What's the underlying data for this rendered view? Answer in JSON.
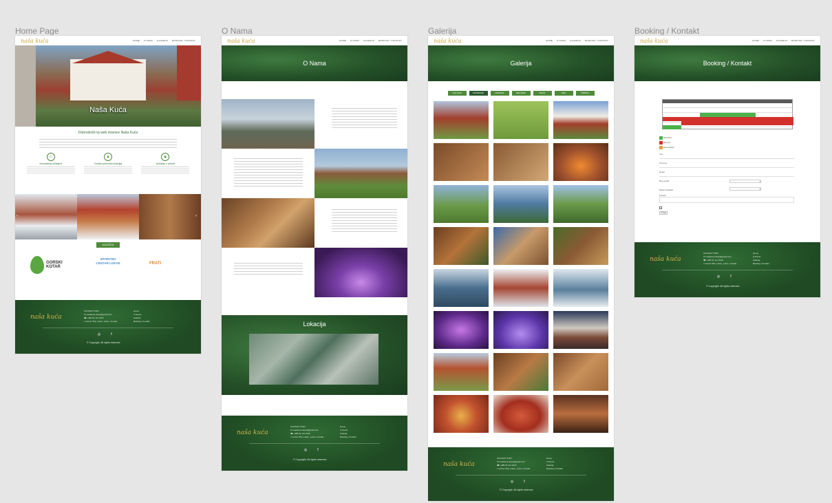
{
  "frames": [
    {
      "title": "Home Page"
    },
    {
      "title": "O Nama"
    },
    {
      "title": "Galerija"
    },
    {
      "title": "Booking / Kontakt"
    }
  ],
  "brand": {
    "logo": "naša kuća",
    "green": "#2f6b34",
    "accent": "#c8a23a",
    "button": "#4f8a3c"
  },
  "nav": {
    "items": [
      "HOME",
      "O NAMA",
      "GALERIJA",
      "BOOKING / KONTAKT"
    ]
  },
  "home": {
    "hero_title": "Naša Kuća",
    "welcome_title": "Dobrodošli na web stranice Naša Kuća",
    "features": [
      "Domaćinski ambijent",
      "Gorsko-primorski doživljaj",
      "Uživanje u prirodi"
    ],
    "gallery_button": "GALERIJA",
    "partners": [
      "GORSKI KOTAR",
      "SPORTSKI CENTAR LOKVE",
      "FRATI"
    ]
  },
  "onama": {
    "title": "O Nama",
    "location_title": "Lokacija"
  },
  "galerija": {
    "title": "Galerija",
    "filters": [
      "SVE SLIKE",
      "EKSTERIJER",
      "INTERIJER",
      "WELLNESS",
      "HRANA",
      "ZIMA",
      "PRIRODA"
    ]
  },
  "booking": {
    "title": "Booking / Kontakt",
    "legend": [
      "Slobodno",
      "Zauzeto",
      "Rezervacija"
    ],
    "form_labels": [
      "Ime",
      "Prezime",
      "Email",
      "Broj osoba",
      "Datum dolaska",
      "Poruka"
    ],
    "submit": "Pošalji"
  },
  "footer": {
    "heading": "KONTAKT INFO",
    "email": "nasakuca.lokve@gmail.com",
    "phone": "+385 91 111 2233",
    "address": "Homer 55a, Lokve, Lokve, Croatia",
    "links": [
      "Home",
      "O Nama",
      "Galerija",
      "Booking / Kontakt"
    ],
    "copyright": "© Copyright. All rights reserved."
  }
}
